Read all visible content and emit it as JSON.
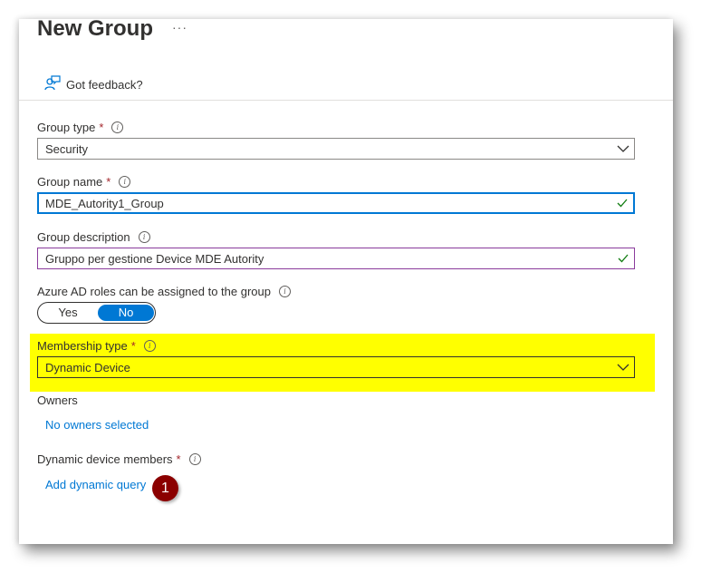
{
  "page": {
    "title": "New Group",
    "more_label": "···"
  },
  "feedback": {
    "label": "Got feedback?",
    "icon": "feedback-icon"
  },
  "form": {
    "group_type": {
      "label": "Group type",
      "required": "*",
      "value": "Security"
    },
    "group_name": {
      "label": "Group name",
      "required": "*",
      "value": "MDE_Autority1_Group"
    },
    "group_description": {
      "label": "Group description",
      "value": "Gruppo per gestione Device MDE Autority"
    },
    "azure_roles": {
      "label": "Azure AD roles can be assigned to the group",
      "yes": "Yes",
      "no": "No",
      "selected": "No"
    },
    "membership_type": {
      "label": "Membership type",
      "required": "*",
      "value": "Dynamic Device"
    },
    "owners": {
      "label": "Owners",
      "link": "No owners selected"
    },
    "dynamic_members": {
      "label": "Dynamic device members",
      "required": "*",
      "link": "Add dynamic query"
    }
  },
  "annotation": {
    "step": "1",
    "highlight_color": "#ffff00",
    "badge_color": "#8b0000"
  },
  "colors": {
    "accent": "#0078d4",
    "required": "#a4262c",
    "focus_border": "#0078d4",
    "description_border": "#8a3b9c",
    "valid_check": "#107c10"
  }
}
